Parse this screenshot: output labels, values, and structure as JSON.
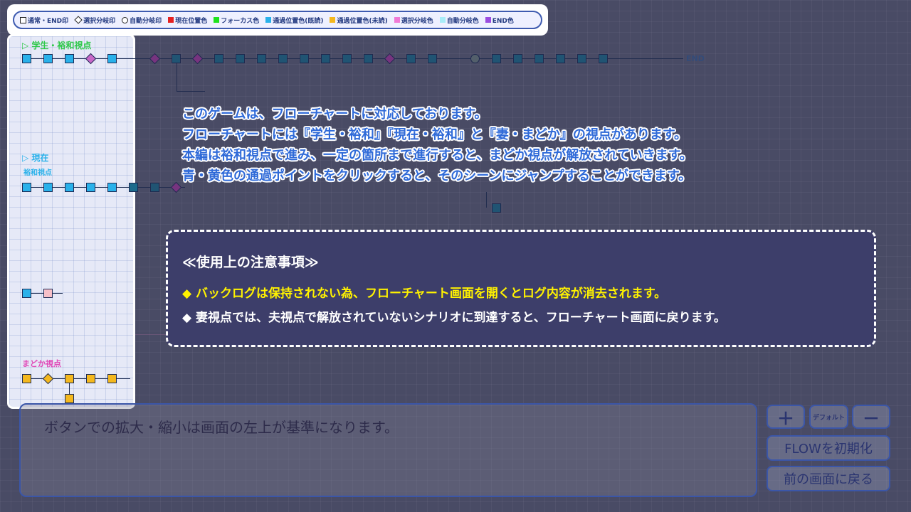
{
  "legend": {
    "items": [
      {
        "shape": "square",
        "color": "#ffffff",
        "label": "通常・END印"
      },
      {
        "shape": "diamond",
        "color": "#ffffff",
        "label": "選択分岐印"
      },
      {
        "shape": "circle",
        "color": "#ffffff",
        "label": "自動分岐印"
      },
      {
        "shape": "fill",
        "color": "#e52121",
        "label": "現在位置色"
      },
      {
        "shape": "fill",
        "color": "#1ee21e",
        "label": "フォーカス色"
      },
      {
        "shape": "fill",
        "color": "#29b1ea",
        "label": "通過位置色(既読)"
      },
      {
        "shape": "fill",
        "color": "#f4b81e",
        "label": "通過位置色(未読)"
      },
      {
        "shape": "fill",
        "color": "#f07ad6",
        "label": "選択分岐色"
      },
      {
        "shape": "fill",
        "color": "#a8ecf8",
        "label": "自動分岐色"
      },
      {
        "shape": "fill",
        "color": "#9b4de0",
        "label": "END色"
      }
    ]
  },
  "sections": {
    "student_label": "▷ 学生・裕和視点",
    "present_label": "▷ 現在",
    "present_sub": "裕和視点",
    "madoka_label": "まどか視点"
  },
  "description": [
    "このゲームは、フローチャートに対応しております。",
    "フローチャートには『学生・裕和』『現在・裕和』と『妻・まどか』の視点があります。",
    "本編は裕和視点で進み、一定の箇所まで進行すると、まどか視点が解放されていきます。",
    "青・黄色の通過ポイントをクリックすると、そのシーンにジャンプすることができます。"
  ],
  "notice": {
    "title": "≪使用上の注意事項≫",
    "item1": "◆ バックログは保持されない為、フローチャート画面を開くとログ内容が消去されます。",
    "item2": "◆ 妻視点では、夫視点で解放されていないシナリオに到達すると、フローチャート画面に戻ります。"
  },
  "end_tag": "END",
  "message": "ボタンでの拡大・縮小は画面の左上が基準になります。",
  "buttons": {
    "zoom_in": "＋",
    "default": "デフォルト",
    "zoom_out": "－",
    "flow_reset": "FLOWを初期化",
    "back": "前の画面に戻る"
  },
  "colors": {
    "panel_border": "#ffffff",
    "description_text": "#2f6ad8",
    "notice_highlight": "#fff200",
    "notice_bg": "#3d3e6a"
  }
}
